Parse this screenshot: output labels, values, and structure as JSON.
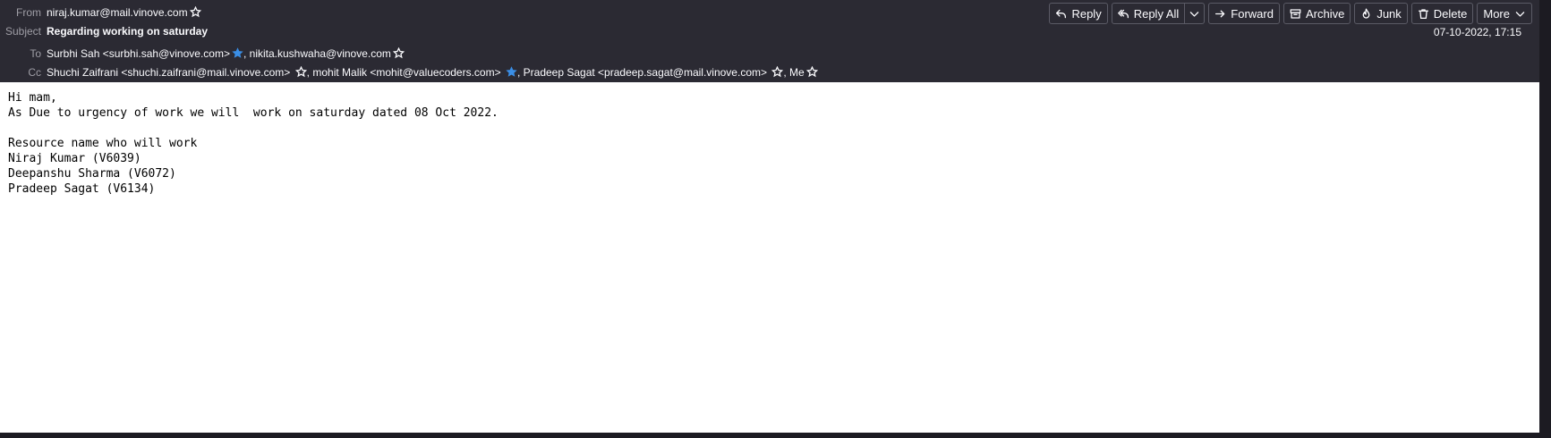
{
  "header": {
    "from_label": "From",
    "from_value": "niraj.kumar@mail.vinove.com",
    "subject_label": "Subject",
    "subject_value": "Regarding working on saturday",
    "to_label": "To",
    "to_1": "Surbhi Sah <surbhi.sah@vinove.com>",
    "to_2": "nikita.kushwaha@vinove.com",
    "cc_label": "Cc",
    "cc_1": "Shuchi Zaifrani <shuchi.zaifrani@mail.vinove.com>",
    "cc_2": "mohit Malik <mohit@valuecoders.com>",
    "cc_3": "Pradeep Sagat <pradeep.sagat@mail.vinove.com>",
    "cc_4": "Me",
    "separator": ",",
    "date": "07-10-2022, 17:15"
  },
  "toolbar": {
    "reply": "Reply",
    "reply_all": "Reply All",
    "forward": "Forward",
    "archive": "Archive",
    "junk": "Junk",
    "delete": "Delete",
    "more": "More"
  },
  "body": {
    "lines": [
      "Hi mam,",
      "As Due to urgency of work we will  work on saturday dated 08 Oct 2022.",
      "",
      "Resource name who will work",
      "Niraj Kumar (V6039)",
      "Deepanshu Sharma (V6072)",
      "Pradeep Sagat (V6134)"
    ]
  },
  "colors": {
    "header_bg": "#2b2a33",
    "star_active": "#3a8ee6",
    "body_bg": "#ffffff"
  }
}
